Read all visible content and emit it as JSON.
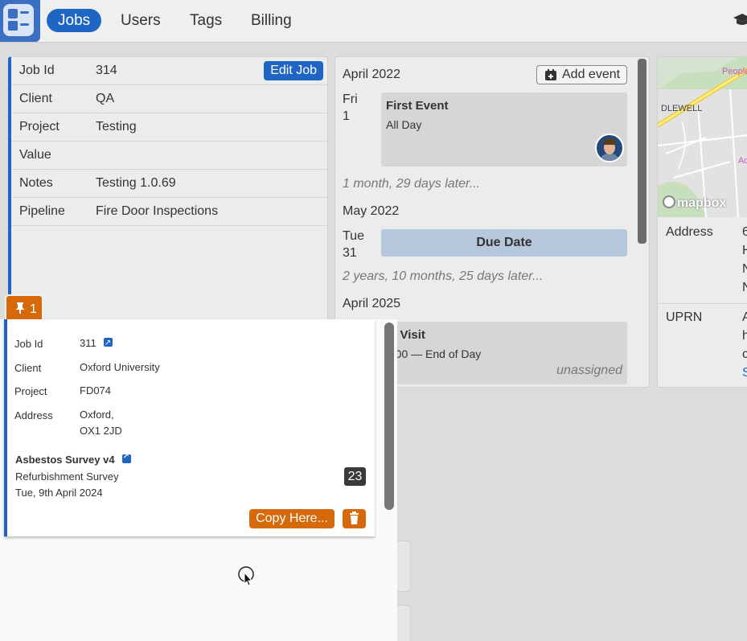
{
  "nav": {
    "items": [
      {
        "label": "Jobs",
        "active": true
      },
      {
        "label": "Users",
        "active": false
      },
      {
        "label": "Tags",
        "active": false
      },
      {
        "label": "Billing",
        "active": false
      }
    ],
    "accent_color": "#1f66c4"
  },
  "job": {
    "edit_label": "Edit Job",
    "fields": [
      {
        "label": "Job Id",
        "value": "314"
      },
      {
        "label": "Client",
        "value": "QA"
      },
      {
        "label": "Project",
        "value": "Testing"
      },
      {
        "label": "Value",
        "value": ""
      },
      {
        "label": "Notes",
        "value": "Testing 1.0.69"
      },
      {
        "label": "Pipeline",
        "value": "Fire Door Inspections"
      }
    ]
  },
  "calendar": {
    "add_event_label": "Add event",
    "month1": "April 2022",
    "day1_name": "Fri",
    "day1_num": "1",
    "event1_title": "First Event",
    "event1_sub": "All Day",
    "gap1": "1 month, 29 days later...",
    "month2": "May 2022",
    "day2_name": "Tue",
    "day2_num": "31",
    "due_label": "Due Date",
    "gap2": "2 years, 10 months, 25 days later...",
    "month3": "April 2025",
    "event3_title": "te Visit",
    "event3_sub": "3:00 — End of Day",
    "event3_assignee": "unassigned"
  },
  "map": {
    "attribution": "mapbox",
    "place_label": "DLEWELL",
    "place_label2": "People",
    "place_label3": "Ad",
    "address_label": "Address",
    "address_lines": [
      "6",
      "H",
      "N",
      "N"
    ],
    "uprn_label": "UPRN",
    "uprn_lines": [
      "A",
      "h",
      "c",
      "S"
    ]
  },
  "pin": {
    "count": "1",
    "color": "#d66a0b"
  },
  "pinned_card": {
    "fields": [
      {
        "label": "Job Id",
        "value": "311"
      },
      {
        "label": "Client",
        "value": "Oxford University"
      },
      {
        "label": "Project",
        "value": "FD074"
      },
      {
        "label": "Address",
        "value_line1": "Oxford,",
        "value_line2": "OX1 2JD"
      }
    ],
    "survey_title": "Asbestos Survey v4",
    "survey_type": "Refurbishment Survey",
    "survey_date": "Tue, 9th April 2024",
    "count": "23",
    "copy_label": "Copy Here..."
  }
}
